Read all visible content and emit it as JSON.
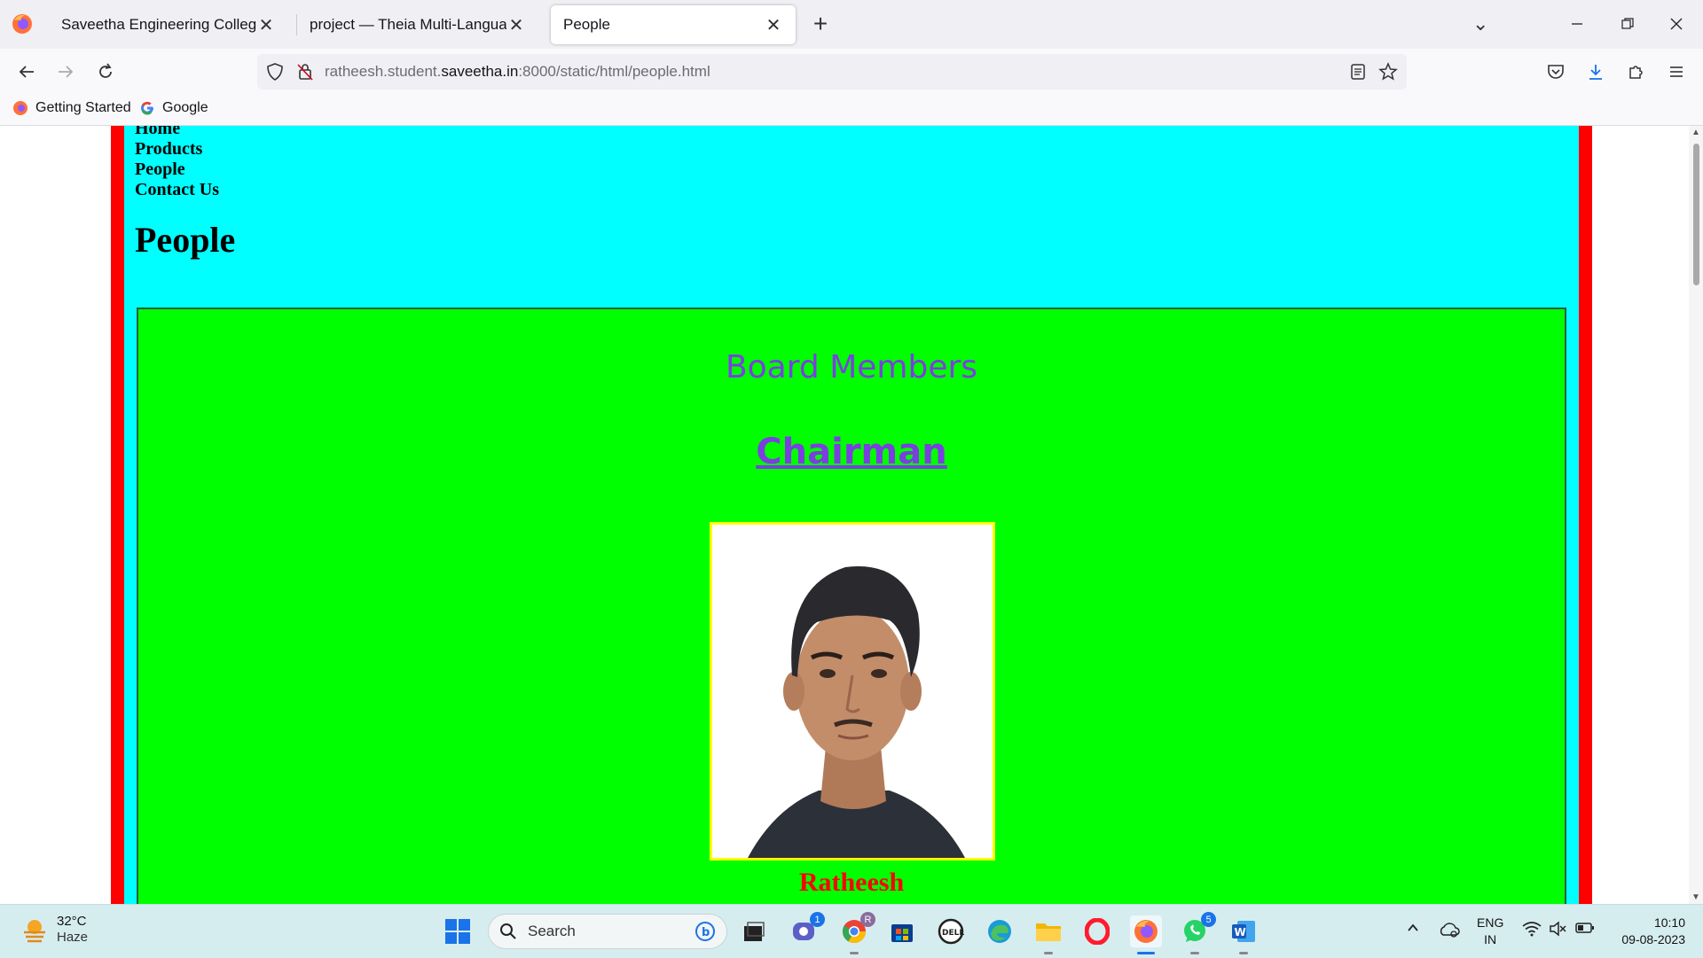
{
  "browser": {
    "tabs": [
      {
        "title": "Saveetha Engineering College",
        "active": false
      },
      {
        "title": "project — Theia Multi-Language Ex",
        "active": false
      },
      {
        "title": "People",
        "active": true
      }
    ],
    "new_tab_symbol": "+",
    "url": {
      "prefix": "ratheesh.student.",
      "domain": "saveetha.in",
      "suffix": ":8000/static/html/people.html"
    },
    "bookmarks": [
      {
        "label": "Getting Started",
        "icon": "firefox-icon"
      },
      {
        "label": "Google",
        "icon": "google-icon"
      }
    ]
  },
  "page": {
    "nav_links": [
      "Home",
      "Products",
      "People",
      "Contact Us"
    ],
    "heading": "People",
    "section_title": "Board Members",
    "role_title": "Chairman",
    "person_name": "Ratheesh",
    "colors": {
      "frame_border": "#ff0000",
      "frame_bg": "#00ffff",
      "content_bg": "#00ff00",
      "title_color": "#7b3fe0",
      "photo_border": "#ffff00",
      "name_color": "#ff0000"
    }
  },
  "taskbar": {
    "weather": {
      "temp": "32°C",
      "condition": "Haze"
    },
    "search_placeholder": "Search",
    "badges": {
      "teams": "1",
      "whatsapp": "5"
    },
    "chrome_badge": "R",
    "language": {
      "line1": "ENG",
      "line2": "IN"
    },
    "clock": {
      "time": "10:10",
      "date": "09-08-2023"
    }
  }
}
